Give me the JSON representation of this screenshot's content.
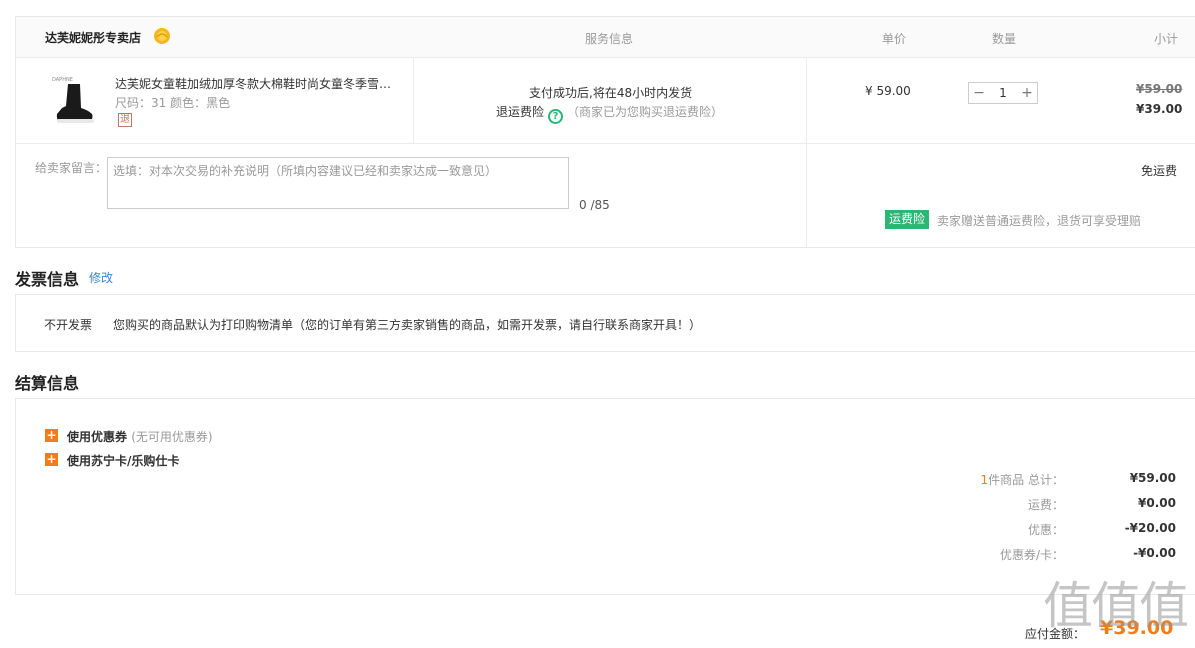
{
  "order": {
    "store_name": "达芙妮妮彤专卖店",
    "columns": {
      "service": "服务信息",
      "unit_price": "单价",
      "quantity": "数量",
      "subtotal": "小计"
    },
    "product": {
      "title": "达芙妮女童鞋加绒加厚冬款大棉鞋时尚女童冬季雪…",
      "spec": "尺码：31   颜色：黑色",
      "return_badge": "退",
      "service_line1": "支付成功后,将在48小时内发货",
      "insurance_label": "退运费险",
      "insurance_note": "（商家已为您购买退运费险）",
      "unit_price": "¥ 59.00",
      "qty_minus": "−",
      "qty": "1",
      "qty_plus": "+",
      "original_subtotal": "¥59.00",
      "subtotal": "¥39.00"
    },
    "message_label": "给卖家留言：",
    "message_placeholder": "选填：对本次交易的补充说明（所填内容建议已经和卖家达成一致意见）",
    "message_count": "0 /85",
    "shipping": "免运费",
    "insurance_badge": "运费险",
    "insurance_text": "卖家赠送普通运费险，退货可享受理赔"
  },
  "invoice": {
    "title": "发票信息",
    "edit": "修改",
    "type": "不开发票",
    "desc": "您购买的商品默认为打印购物清单（您的订单有第三方卖家销售的商品，如需开发票，请自行联系商家开具！）"
  },
  "settlement": {
    "title": "结算信息",
    "coupon_label": "使用优惠券",
    "coupon_note": "(无可用优惠券)",
    "card_label": "使用苏宁卡/乐购仕卡",
    "item_count": "1",
    "total_label": "件商品 总计：",
    "total": "¥59.00",
    "freight_label": "运费：",
    "freight": "¥0.00",
    "discount_label": "优惠：",
    "discount": "-¥20.00",
    "voucher_label": "优惠券/卡：",
    "voucher": "-¥0.00",
    "pay_label": "应付金额：",
    "pay_total": "¥39.00"
  },
  "watermark": "值值值",
  "colors": {
    "accent": "#f07d1a",
    "green": "#2bb673",
    "link": "#3d83c9"
  }
}
